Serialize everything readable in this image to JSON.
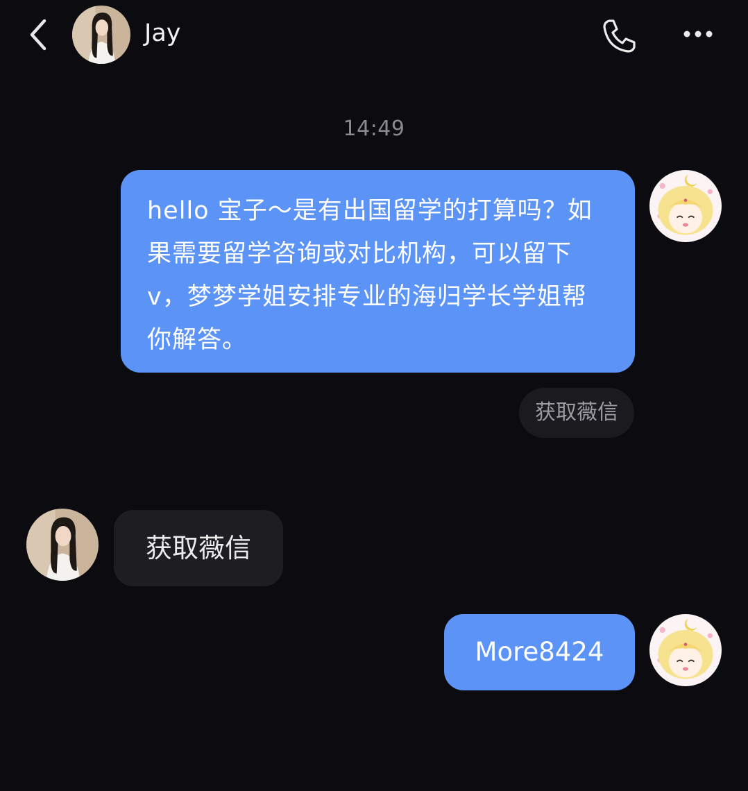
{
  "header": {
    "contact_name": "Jay",
    "icons": {
      "back": "chevron-left-icon",
      "call": "phone-icon",
      "more": "more-horizontal-icon"
    }
  },
  "conversation": {
    "timestamp": "14:49",
    "messages": [
      {
        "sender": "me",
        "text": "hello 宝子～是有出国留学的打算吗？如果需要留学咨询或对比机构，可以留下v，梦梦学姐安排专业的海归学长学姐帮你解答。"
      },
      {
        "sender": "Jay",
        "text": "获取薇信"
      },
      {
        "sender": "me",
        "text": "More8424"
      }
    ],
    "quick_reply": "获取薇信"
  },
  "colors": {
    "background": "#0c0c10",
    "outgoing_bubble": "#5b93f6",
    "incoming_bubble": "#1d1d22",
    "timestamp_text": "#8a8a90"
  }
}
